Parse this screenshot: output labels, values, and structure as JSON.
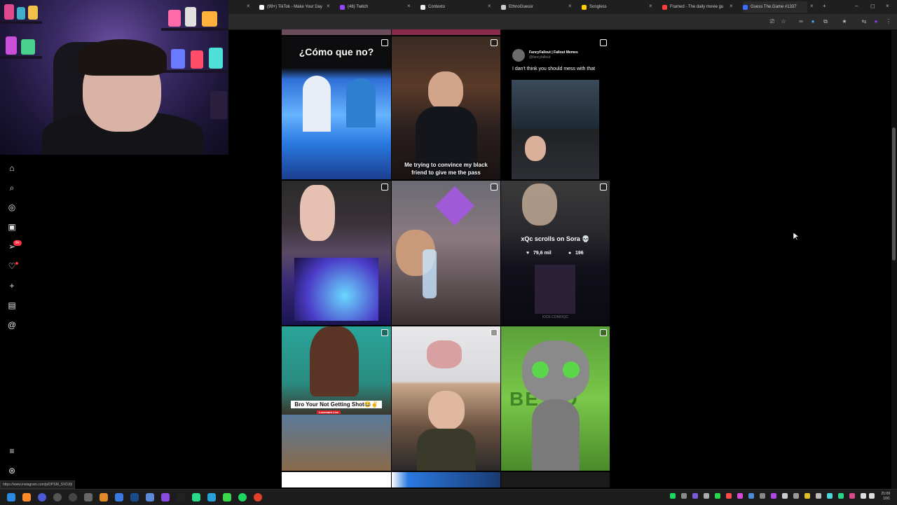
{
  "browser": {
    "tabs": [
      {
        "label": "(99+) TikTok - Make Your Day",
        "color": "#ffffff"
      },
      {
        "label": "(46) Twitch",
        "color": "#9146ff"
      },
      {
        "label": "Contexto",
        "color": "#ffffff"
      },
      {
        "label": "EthnoGuessr",
        "color": "#cccccc"
      },
      {
        "label": "Songless",
        "color": "#ffcc00"
      },
      {
        "label": "Framed - The daily movie gu",
        "color": "#ff3b3b"
      },
      {
        "label": "Guess The.Game #1337",
        "color": "#3b6bff"
      }
    ],
    "new_tab": "+",
    "window_controls": [
      "–",
      "◻",
      "×"
    ]
  },
  "sidebar": {
    "items": [
      {
        "icon": "home-icon",
        "glyph": "⌂"
      },
      {
        "icon": "search-icon",
        "glyph": "⌕"
      },
      {
        "icon": "explore-icon",
        "glyph": "◎"
      },
      {
        "icon": "reels-icon",
        "glyph": "▣"
      },
      {
        "icon": "messages-icon",
        "glyph": "➢",
        "badge": "9+"
      },
      {
        "icon": "notifications-icon",
        "glyph": "♡"
      },
      {
        "icon": "create-icon",
        "glyph": "+"
      },
      {
        "icon": "dashboard-icon",
        "glyph": "▤"
      },
      {
        "icon": "threads-icon",
        "glyph": "@"
      }
    ],
    "more": {
      "icon": "menu-icon",
      "glyph": "≡"
    },
    "meta": {
      "icon": "meta-icon",
      "glyph": "⊛"
    }
  },
  "posts": {
    "p1_caption": "¿Cómo que no?",
    "p2_caption": "Me trying to convince my black friend to give me the pass",
    "p3_name": "FancyFallout | Fallout Memes",
    "p3_handle": "@fancyfallout",
    "p3_text": "I dan't think you should mess with that",
    "p6_title": "xQc scrolls on Sora 💀",
    "p6_likes": "79,6 mil",
    "p6_comments": "196",
    "p6_watermark": "KICK.COM/XQC",
    "p7_caption": "Bro Your Not Getting Shot😂✌",
    "p7_live": "Lovemark Live",
    "p9_text": "BE BO"
  },
  "status_url": "https://www.instagram.com/p/DPSM_SVDJfj/",
  "clock": {
    "time": "21:09",
    "date": "10/1"
  },
  "colors": {
    "badge": "#ff3040",
    "page_bg": "#000000",
    "toolbar": "#2b2b2b"
  }
}
